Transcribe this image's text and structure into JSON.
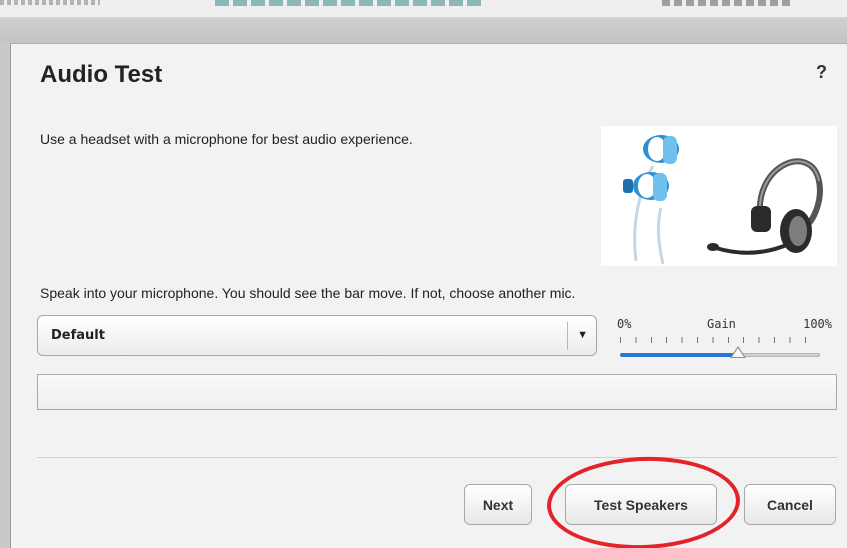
{
  "dialog": {
    "title": "Audio Test",
    "help": "?",
    "instruction": "Use a headset with a microphone for best audio experience.",
    "speak_instruction": "Speak into your microphone. You should see the bar move. If not, choose another mic."
  },
  "mic_select": {
    "value": "Default"
  },
  "gain": {
    "min_label": "0%",
    "label": "Gain",
    "max_label": "100%",
    "level": 0.59
  },
  "buttons": {
    "next": "Next",
    "test_speakers": "Test Speakers",
    "cancel": "Cancel"
  },
  "colors": {
    "annotation": "#e2232a",
    "slider_fill": "#2a78d6",
    "earbud_blue": "#2d8fd4"
  },
  "icons": {
    "help": "question-mark-icon",
    "dropdown": "chevron-down-icon",
    "image": "headset-earbuds-image"
  }
}
